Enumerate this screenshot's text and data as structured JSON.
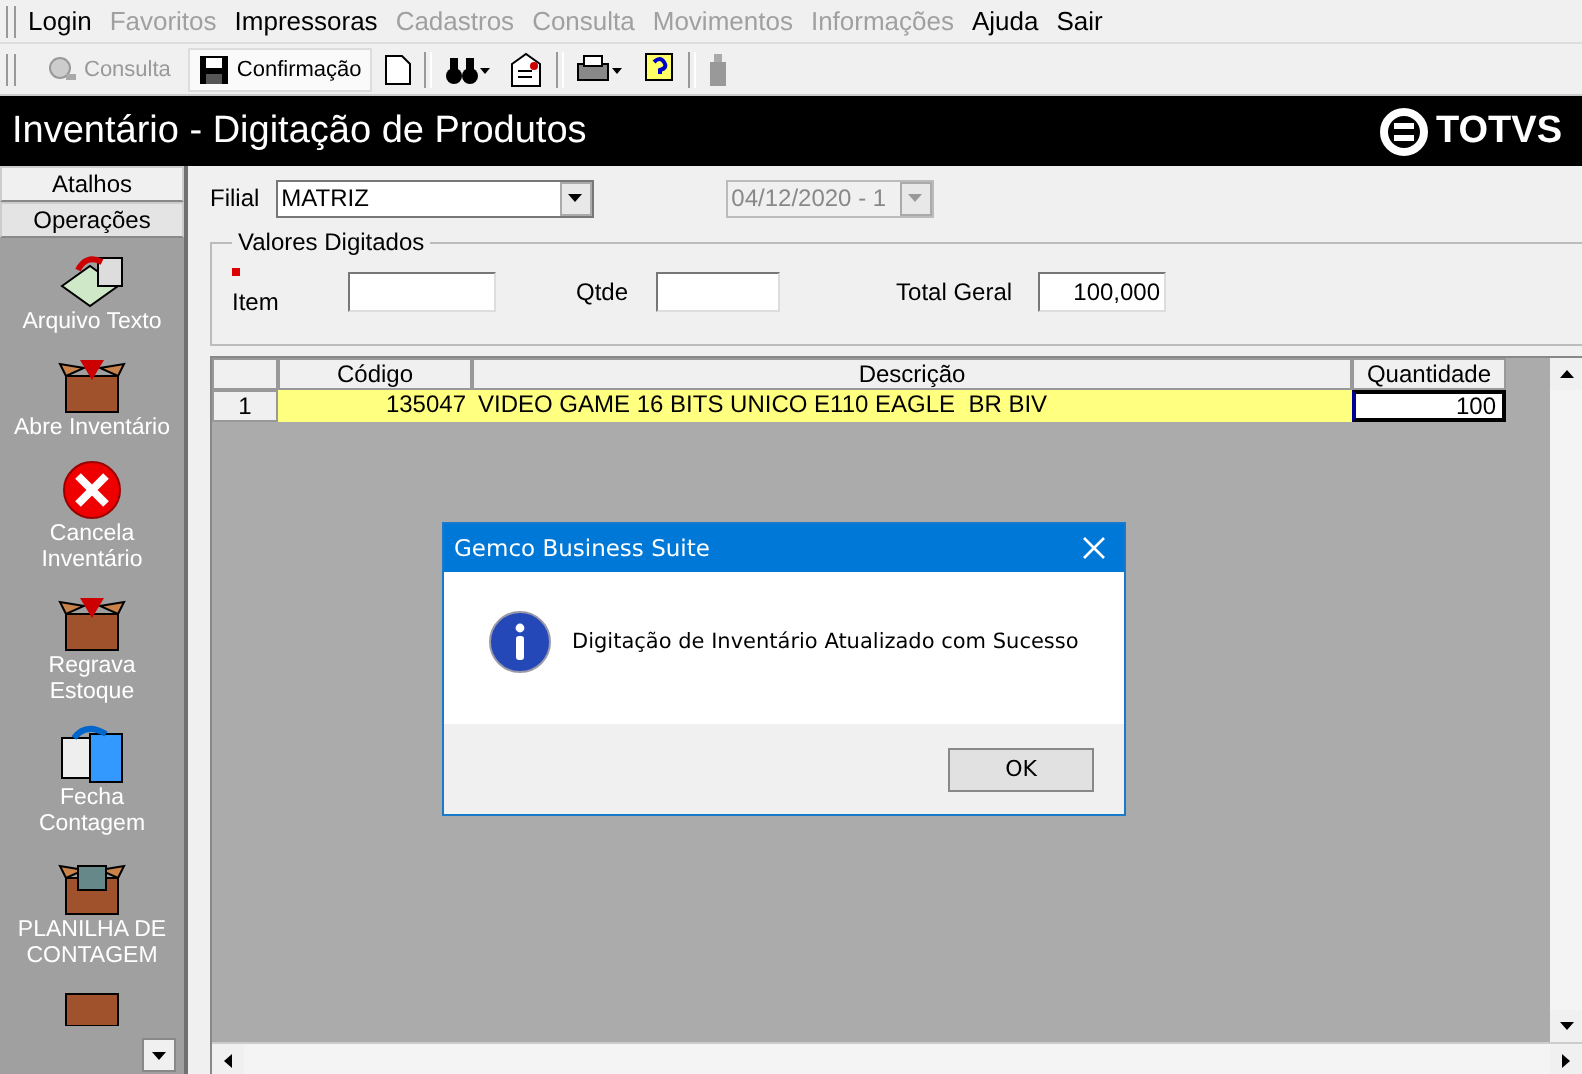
{
  "menu": [
    {
      "label": "Login",
      "disabled": false
    },
    {
      "label": "Favoritos",
      "disabled": true
    },
    {
      "label": "Impressoras",
      "disabled": false
    },
    {
      "label": "Cadastros",
      "disabled": true
    },
    {
      "label": "Consulta",
      "disabled": true
    },
    {
      "label": "Movimentos",
      "disabled": true
    },
    {
      "label": "Informações",
      "disabled": true
    },
    {
      "label": "Ajuda",
      "disabled": false
    },
    {
      "label": "Sair",
      "disabled": false
    }
  ],
  "toolbar": [
    {
      "label": "Consulta",
      "disabled": true,
      "selected": false
    },
    {
      "label": "Confirmação",
      "disabled": false,
      "selected": true
    }
  ],
  "title": "Inventário - Digitação de Produtos",
  "logo": "TOTVS",
  "sidebar": {
    "tabs": [
      {
        "label": "Atalhos",
        "selected": false
      },
      {
        "label": "Operações",
        "selected": true
      }
    ],
    "items": [
      {
        "label": "Arquivo Texto"
      },
      {
        "label": "Abre Inventário"
      },
      {
        "label": "Cancela Inventário"
      },
      {
        "label": "Regrava Estoque"
      },
      {
        "label": "Fecha Contagem"
      },
      {
        "label": "PLANILHA DE CONTAGEM"
      }
    ]
  },
  "filial": {
    "label": "Filial",
    "value": "MATRIZ"
  },
  "date": {
    "value": "04/12/2020 - 1",
    "disabled": true
  },
  "group": {
    "title": "Valores Digitados",
    "item_label": "Item",
    "qtde_label": "Qtde",
    "total_label": "Total Geral",
    "total_value": "100,000"
  },
  "grid": {
    "columns": [
      "Código",
      "Descrição",
      "Quantidade"
    ],
    "rows": [
      {
        "index": "1",
        "codigo": "135047",
        "descricao": "VIDEO GAME 16 BITS UNICO E110 EAGLE  BR BIV",
        "quantidade": "100"
      }
    ]
  },
  "dialog": {
    "title": "Gemco Business Suite",
    "message": "Digitação de Inventário Atualizado com Sucesso",
    "button": "OK"
  }
}
